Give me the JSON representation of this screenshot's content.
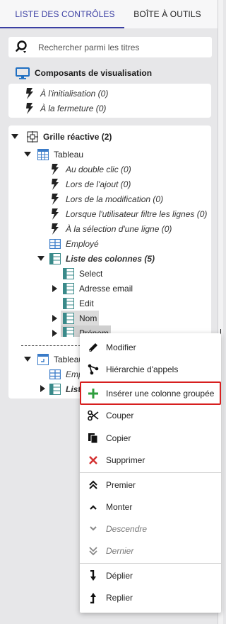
{
  "tabs": [
    {
      "label": "LISTE DES CONTRÔLES",
      "active": true
    },
    {
      "label": "BOÎTE À OUTILS",
      "active": false
    }
  ],
  "search": {
    "placeholder": "Rechercher parmi les titres"
  },
  "section": {
    "title": "Composants de visualisation"
  },
  "events_panel": {
    "items": [
      "À l'initialisation (0)",
      "À la fermeture (0)"
    ]
  },
  "tree": {
    "grid": "Grille réactive (2)",
    "table1": "Tableau",
    "events": [
      "Au double clic (0)",
      "Lors de l'ajout (0)",
      "Lors de la modification (0)",
      "Lorsque l'utilisateur filtre les lignes (0)",
      "À la sélection d'une ligne (0)"
    ],
    "employe": "Employé",
    "col_list": "Liste des colonnes (5)",
    "columns": [
      "Select",
      "Adresse email",
      "Edit",
      "Nom",
      "Prénom"
    ],
    "table2": "Tableau",
    "employe2": "Emp",
    "list2": "List"
  },
  "context_menu": {
    "items": [
      {
        "label": "Modifier",
        "icon": "pencil-icon"
      },
      {
        "label": "Hiérarchie d'appels",
        "icon": "hierarchy-icon"
      },
      {
        "label": "Insérer une colonne groupée",
        "icon": "plus-icon"
      },
      {
        "label": "Couper",
        "icon": "scissors-icon"
      },
      {
        "label": "Copier",
        "icon": "copy-icon"
      },
      {
        "label": "Supprimer",
        "icon": "delete-x-icon"
      },
      {
        "label": "Premier",
        "icon": "double-chevron-up-icon"
      },
      {
        "label": "Monter",
        "icon": "chevron-up-icon"
      },
      {
        "label": "Descendre",
        "icon": "chevron-down-icon"
      },
      {
        "label": "Dernier",
        "icon": "double-chevron-down-icon"
      },
      {
        "label": "Déplier",
        "icon": "expand-arrow-icon"
      },
      {
        "label": "Replier",
        "icon": "collapse-arrow-icon"
      }
    ]
  },
  "colors": {
    "accent": "#3b3fa3",
    "highlight_border": "#d71f1f",
    "plus_green": "#2e9e3e",
    "delete_red": "#d32f2f",
    "table_icon_blue": "#3a7bc8",
    "col_icon_teal": "#3a8a8a"
  }
}
